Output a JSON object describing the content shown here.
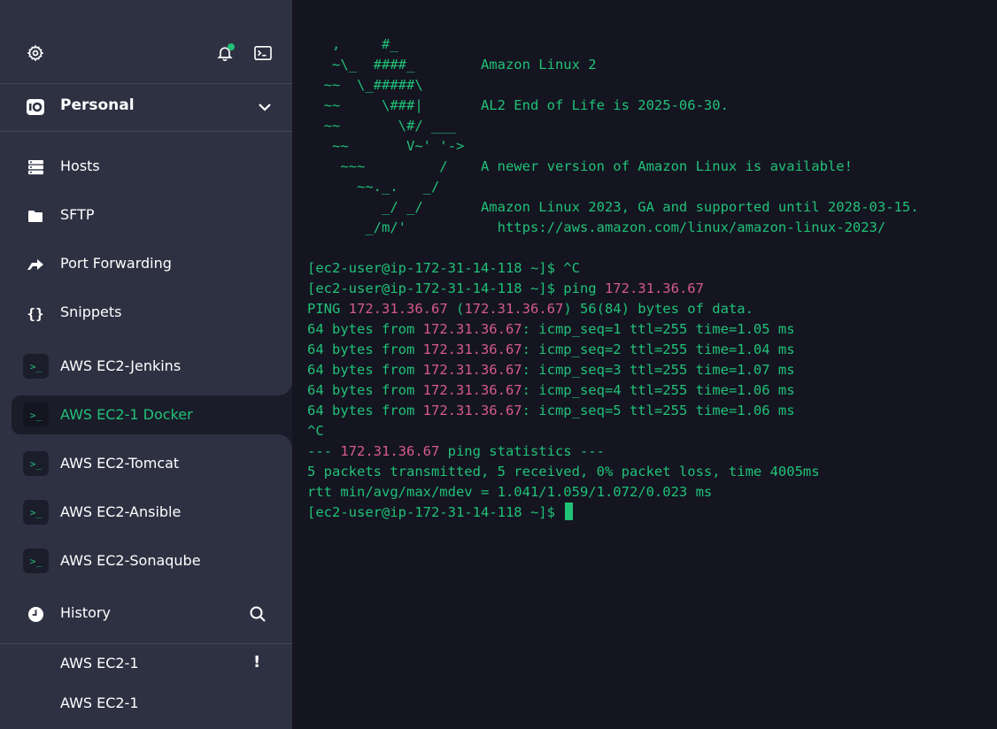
{
  "sidebar": {
    "top_icons": [
      "gear-icon",
      "bell-icon",
      "terminal-icon"
    ],
    "vault": {
      "label": "Personal",
      "icon": "vault-icon"
    },
    "nav": [
      {
        "label": "Hosts",
        "icon": "server-icon"
      },
      {
        "label": "SFTP",
        "icon": "folder-icon"
      },
      {
        "label": "Port Forwarding",
        "icon": "forward-arrow-icon"
      },
      {
        "label": "Snippets",
        "icon": "braces-icon"
      }
    ],
    "hosts": [
      {
        "label": "AWS EC2-Jenkins",
        "badge": ">_",
        "active": false
      },
      {
        "label": "AWS EC2-1 Docker",
        "badge": ">_",
        "active": true
      },
      {
        "label": "AWS EC2-Tomcat",
        "badge": ">_",
        "active": false
      },
      {
        "label": "AWS EC2-Ansible",
        "badge": ">_",
        "active": false
      },
      {
        "label": "AWS EC2-Sonaqube",
        "badge": ">_",
        "active": false
      }
    ],
    "history": {
      "label": "History",
      "icon": "clock-icon"
    },
    "recent": [
      {
        "label": "AWS EC2-1",
        "warning": "!"
      },
      {
        "label": "AWS EC2-1",
        "warning": ""
      }
    ]
  },
  "terminal": {
    "lines": [
      "   ,     #_",
      "   ~\\_  ####_        Amazon Linux 2",
      "  ~~  \\_#####\\",
      "  ~~     \\###|       AL2 End of Life is 2025-06-30.",
      "  ~~       \\#/ ___",
      "   ~~       V~' '->",
      "    ~~~         /    A newer version of Amazon Linux is available!",
      "      ~~._.   _/",
      "         _/ _/       Amazon Linux 2023, GA and supported until 2028-03-15.",
      "       _/m/'           https://aws.amazon.com/linux/amazon-linux-2023/",
      "",
      "[ec2-user@ip-172-31-14-118 ~]$ ^C",
      "[ec2-user@ip-172-31-14-118 ~]$ ping 172.31.36.67",
      "PING 172.31.36.67 (172.31.36.67) 56(84) bytes of data.",
      "64 bytes from 172.31.36.67: icmp_seq=1 ttl=255 time=1.05 ms",
      "64 bytes from 172.31.36.67: icmp_seq=2 ttl=255 time=1.04 ms",
      "64 bytes from 172.31.36.67: icmp_seq=3 ttl=255 time=1.07 ms",
      "64 bytes from 172.31.36.67: icmp_seq=4 ttl=255 time=1.06 ms",
      "64 bytes from 172.31.36.67: icmp_seq=5 ttl=255 time=1.06 ms",
      "^C",
      "--- 172.31.36.67 ping statistics ---",
      "5 packets transmitted, 5 received, 0% packet loss, time 4005ms",
      "rtt min/avg/max/mdev = 1.041/1.059/1.072/0.023 ms",
      "[ec2-user@ip-172-31-14-118 ~]$ "
    ],
    "highlight": "172.31.36.67"
  },
  "colors": {
    "sidebar_bg": "#2e3142",
    "terminal_bg": "#141521",
    "accent_green": "#21c177",
    "ip_pink": "#d65a8e"
  }
}
